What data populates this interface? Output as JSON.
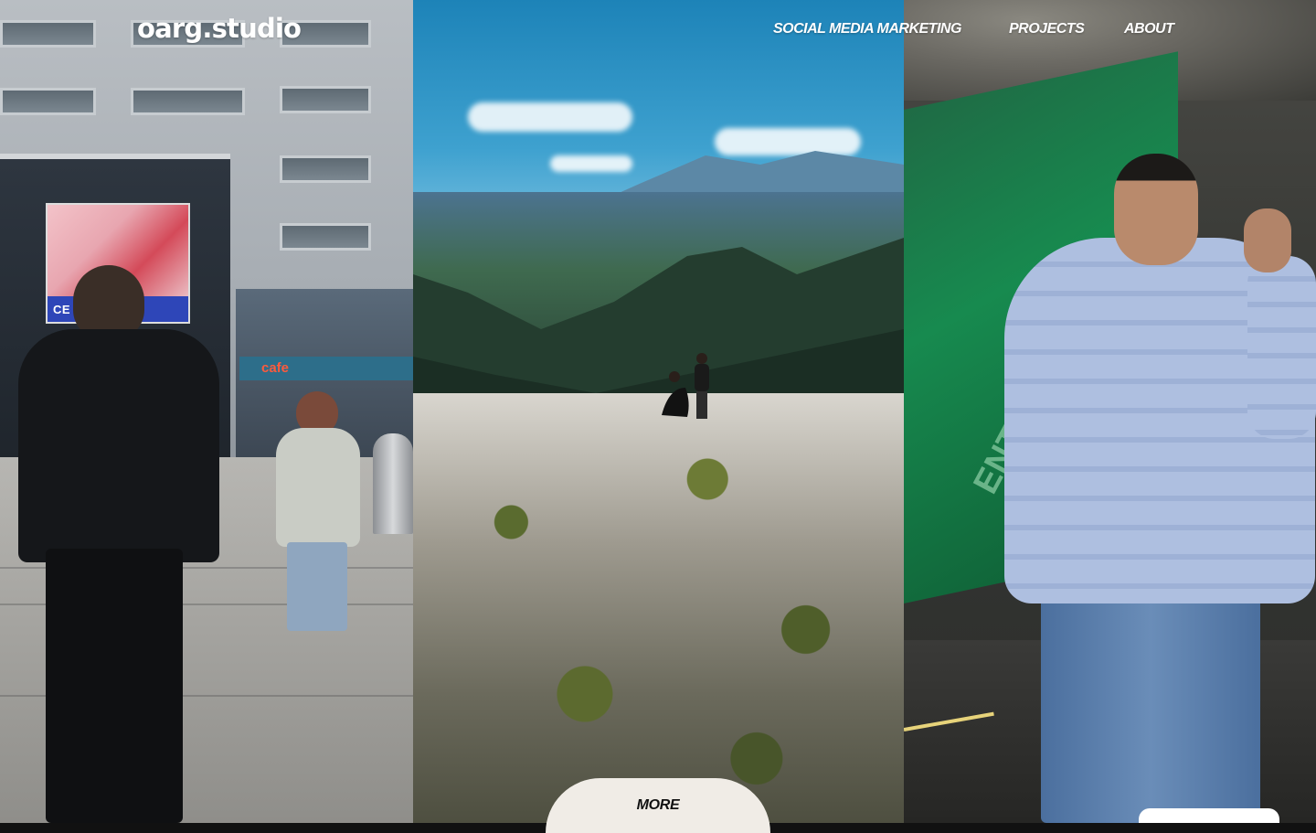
{
  "header": {
    "logo": "oarg.studio",
    "nav": [
      {
        "label": "SOCIAL MEDIA MARKETING"
      },
      {
        "label": "PROJECTS"
      },
      {
        "label": "ABOUT"
      }
    ]
  },
  "panels": {
    "left": {
      "billboard_text": "CE  N MITTE",
      "cafe_sign": "cafe"
    },
    "right": {
      "escalator_text": "ENTD"
    }
  },
  "cta": {
    "more_label": "MORE"
  },
  "colors": {
    "nav_text": "#ffffff",
    "button_bg": "#f0ece6",
    "button_text": "#111111"
  }
}
